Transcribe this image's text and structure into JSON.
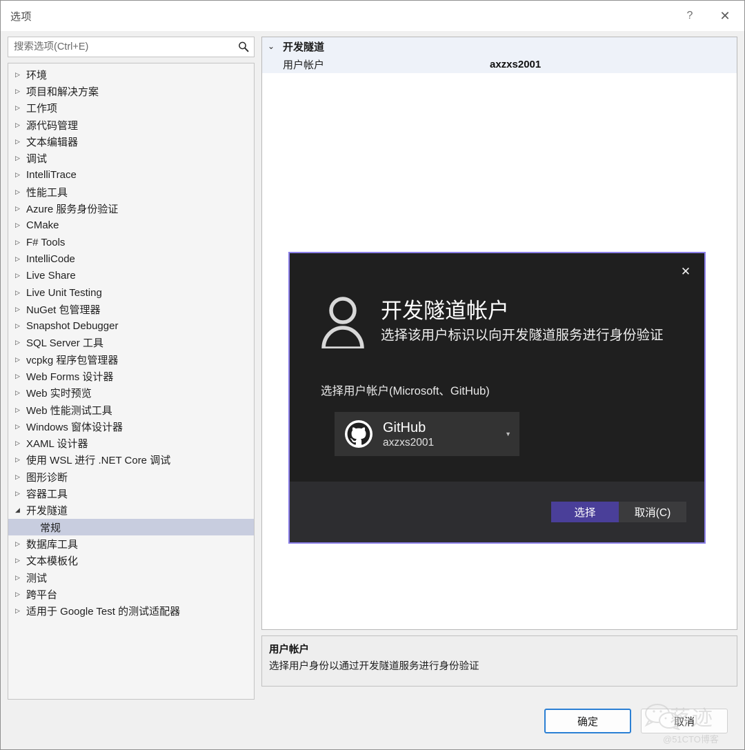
{
  "window": {
    "title": "选项",
    "help_label": "?",
    "close_label": "✕"
  },
  "search": {
    "placeholder": "搜索选项(Ctrl+E)",
    "value": "",
    "icon": "search-icon"
  },
  "tree": {
    "expander_collapsed": "▷",
    "expander_expanded": "◢",
    "items": [
      {
        "label": "环境",
        "expandable": true,
        "expanded": false,
        "selected": false,
        "child": false
      },
      {
        "label": "项目和解决方案",
        "expandable": true,
        "expanded": false,
        "selected": false,
        "child": false
      },
      {
        "label": "工作项",
        "expandable": true,
        "expanded": false,
        "selected": false,
        "child": false
      },
      {
        "label": "源代码管理",
        "expandable": true,
        "expanded": false,
        "selected": false,
        "child": false
      },
      {
        "label": "文本编辑器",
        "expandable": true,
        "expanded": false,
        "selected": false,
        "child": false
      },
      {
        "label": "调试",
        "expandable": true,
        "expanded": false,
        "selected": false,
        "child": false
      },
      {
        "label": "IntelliTrace",
        "expandable": true,
        "expanded": false,
        "selected": false,
        "child": false
      },
      {
        "label": "性能工具",
        "expandable": true,
        "expanded": false,
        "selected": false,
        "child": false
      },
      {
        "label": "Azure 服务身份验证",
        "expandable": true,
        "expanded": false,
        "selected": false,
        "child": false
      },
      {
        "label": "CMake",
        "expandable": true,
        "expanded": false,
        "selected": false,
        "child": false
      },
      {
        "label": "F# Tools",
        "expandable": true,
        "expanded": false,
        "selected": false,
        "child": false
      },
      {
        "label": "IntelliCode",
        "expandable": true,
        "expanded": false,
        "selected": false,
        "child": false
      },
      {
        "label": "Live Share",
        "expandable": true,
        "expanded": false,
        "selected": false,
        "child": false
      },
      {
        "label": "Live Unit Testing",
        "expandable": true,
        "expanded": false,
        "selected": false,
        "child": false
      },
      {
        "label": "NuGet 包管理器",
        "expandable": true,
        "expanded": false,
        "selected": false,
        "child": false
      },
      {
        "label": "Snapshot Debugger",
        "expandable": true,
        "expanded": false,
        "selected": false,
        "child": false
      },
      {
        "label": "SQL Server 工具",
        "expandable": true,
        "expanded": false,
        "selected": false,
        "child": false
      },
      {
        "label": "vcpkg 程序包管理器",
        "expandable": true,
        "expanded": false,
        "selected": false,
        "child": false
      },
      {
        "label": "Web Forms 设计器",
        "expandable": true,
        "expanded": false,
        "selected": false,
        "child": false
      },
      {
        "label": "Web 实时预览",
        "expandable": true,
        "expanded": false,
        "selected": false,
        "child": false
      },
      {
        "label": "Web 性能测试工具",
        "expandable": true,
        "expanded": false,
        "selected": false,
        "child": false
      },
      {
        "label": "Windows 窗体设计器",
        "expandable": true,
        "expanded": false,
        "selected": false,
        "child": false
      },
      {
        "label": "XAML 设计器",
        "expandable": true,
        "expanded": false,
        "selected": false,
        "child": false
      },
      {
        "label": "使用 WSL 进行 .NET Core 调试",
        "expandable": true,
        "expanded": false,
        "selected": false,
        "child": false
      },
      {
        "label": "图形诊断",
        "expandable": true,
        "expanded": false,
        "selected": false,
        "child": false
      },
      {
        "label": "容器工具",
        "expandable": true,
        "expanded": false,
        "selected": false,
        "child": false
      },
      {
        "label": "开发隧道",
        "expandable": true,
        "expanded": true,
        "selected": false,
        "child": false
      },
      {
        "label": "常规",
        "expandable": false,
        "expanded": false,
        "selected": true,
        "child": true
      },
      {
        "label": "数据库工具",
        "expandable": true,
        "expanded": false,
        "selected": false,
        "child": false
      },
      {
        "label": "文本模板化",
        "expandable": true,
        "expanded": false,
        "selected": false,
        "child": false
      },
      {
        "label": "测试",
        "expandable": true,
        "expanded": false,
        "selected": false,
        "child": false
      },
      {
        "label": "跨平台",
        "expandable": true,
        "expanded": false,
        "selected": false,
        "child": false
      },
      {
        "label": "适用于 Google Test 的测试适配器",
        "expandable": true,
        "expanded": false,
        "selected": false,
        "child": false
      }
    ]
  },
  "property_grid": {
    "category_chevron": "⌄",
    "category": "开发隧道",
    "rows": [
      {
        "label": "用户帐户",
        "value": "axzxs2001"
      }
    ]
  },
  "description": {
    "title": "用户帐户",
    "text": "选择用户身份以通过开发隧道服务进行身份验证"
  },
  "footer": {
    "ok_label": "确定",
    "cancel_label": "取消"
  },
  "watermark": {
    "text": "蒋迹",
    "sub": "@51CTO博客",
    "icon": "wechat-icon"
  },
  "modal": {
    "close_label": "✕",
    "avatar_icon": "person-icon",
    "title": "开发隧道帐户",
    "subtitle": "选择该用户标识以向开发隧道服务进行身份验证",
    "prompt": "选择用户帐户(Microsoft、GitHub)",
    "account": {
      "icon": "github-icon",
      "provider": "GitHub",
      "username": "axzxs2001",
      "caret": "▼"
    },
    "select_label": "选择",
    "cancel_label": "取消(C)",
    "colors": {
      "border": "#8b7fe8",
      "background": "#1f1f1f",
      "footer": "#2d2d30",
      "primary_button": "#4a3f99"
    }
  }
}
